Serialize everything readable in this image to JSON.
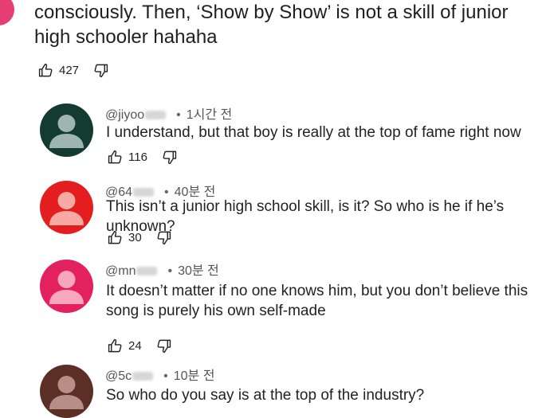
{
  "parent_comment": {
    "text": "consciously. Then, ‘Show by Show’ is not a skill of junior high schooler hahaha",
    "likes": "427",
    "avatar_color": "#e63d74"
  },
  "replies": [
    {
      "handle": "@jiyoo",
      "time": "1시간 전",
      "text": "I understand, but that boy is really at the top of fame right now",
      "likes": "116",
      "avatar_bg": "#133b31",
      "avatar_fg": "#9fb5b0"
    },
    {
      "handle": "@64",
      "time": "40분 전",
      "text": "This isn’t a junior high school skill, is it? So who is he if he’s unknown?",
      "likes": "30",
      "avatar_bg": "#e41e1e",
      "avatar_fg": "#f7a9a3"
    },
    {
      "handle": "@mn",
      "time": "30분 전",
      "text": "It doesn’t matter if no one knows him, but you don’t believe this song is purely his own self-made",
      "likes": "24",
      "avatar_bg": "#e3215f",
      "avatar_fg": "#f8a7bf"
    },
    {
      "handle": "@5c",
      "time": "10분 전",
      "text": "So who do you say is at the top of the industry?",
      "avatar_bg": "#5b2f26",
      "avatar_fg": "#b88f86"
    }
  ]
}
